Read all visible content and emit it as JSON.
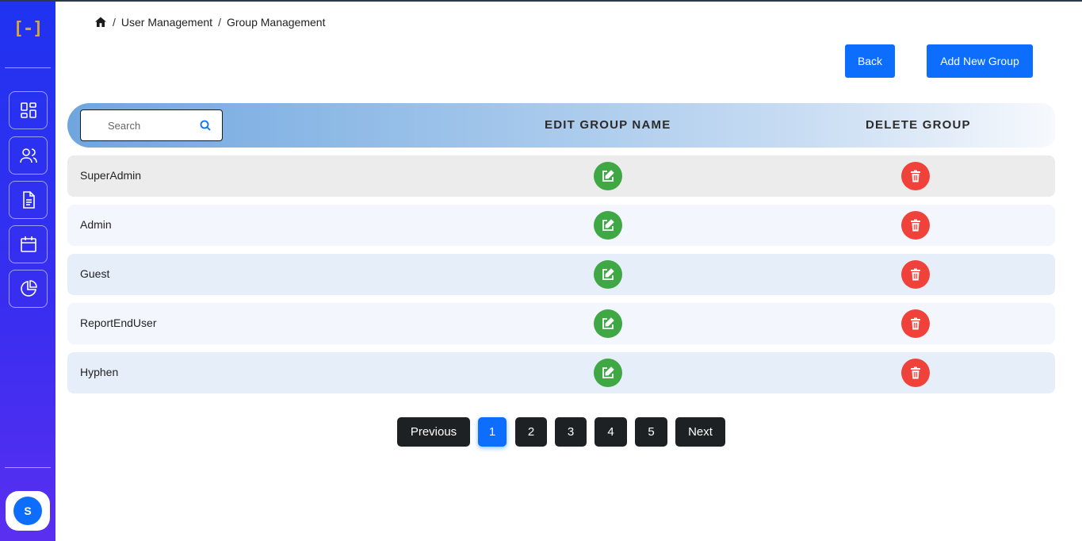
{
  "sidebar": {
    "logo": "[-]",
    "nav": [
      {
        "name": "dashboard-icon"
      },
      {
        "name": "users-icon"
      },
      {
        "name": "document-icon"
      },
      {
        "name": "calendar-icon"
      },
      {
        "name": "pie-chart-icon"
      }
    ],
    "avatar_initial": "S"
  },
  "breadcrumb": {
    "home_icon": "home-icon",
    "items": [
      "User Management",
      "Group Management"
    ],
    "separator": "/"
  },
  "actions": {
    "back_label": "Back",
    "add_label": "Add New Group"
  },
  "table": {
    "search_placeholder": "Search",
    "col_edit": "EDIT GROUP NAME",
    "col_delete": "DELETE GROUP",
    "rows": [
      {
        "name": "SuperAdmin"
      },
      {
        "name": "Admin"
      },
      {
        "name": "Guest"
      },
      {
        "name": "ReportEndUser"
      },
      {
        "name": "Hyphen"
      }
    ]
  },
  "pagination": {
    "previous": "Previous",
    "pages": [
      "1",
      "2",
      "3",
      "4",
      "5"
    ],
    "current": "1",
    "next": "Next"
  },
  "colors": {
    "primary": "#0d6efd",
    "edit": "#3fa845",
    "delete": "#f0423a",
    "sidebar": "#1f33f0"
  }
}
